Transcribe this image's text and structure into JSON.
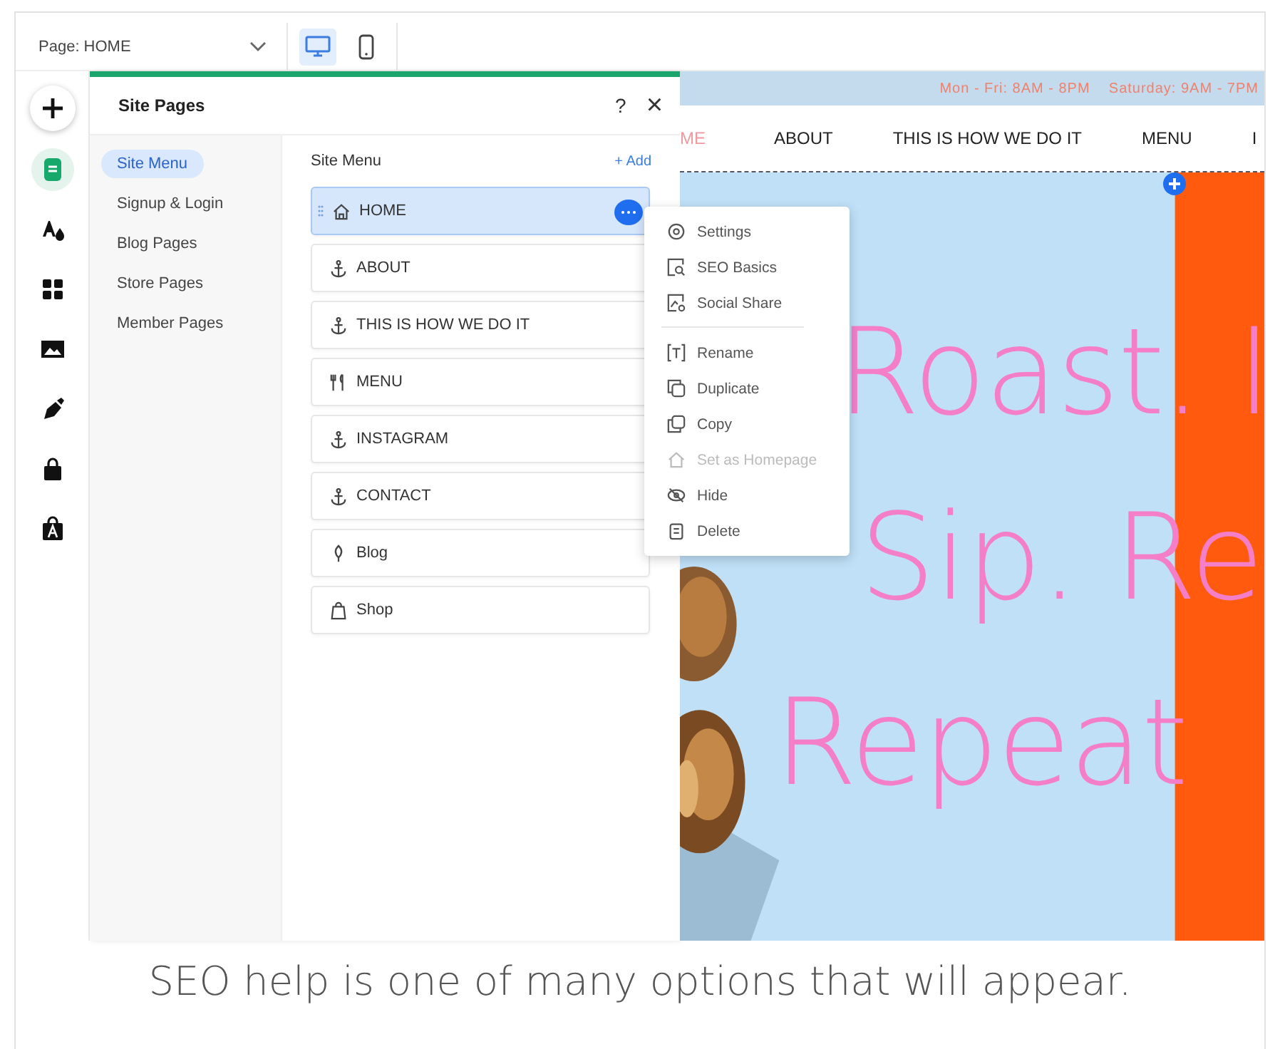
{
  "top_bar": {
    "page_label": "Page: HOME",
    "devices": [
      {
        "kind": "desktop",
        "selected": true
      },
      {
        "kind": "mobile",
        "selected": false
      }
    ]
  },
  "rail": [
    {
      "kind": "add",
      "selected": false
    },
    {
      "kind": "pages",
      "selected": true
    },
    {
      "kind": "theme",
      "selected": false
    },
    {
      "kind": "apps",
      "selected": false
    },
    {
      "kind": "media",
      "selected": false
    },
    {
      "kind": "pen",
      "selected": false
    },
    {
      "kind": "store",
      "selected": false
    },
    {
      "kind": "bag",
      "selected": false
    }
  ],
  "panel": {
    "title": "Site Pages",
    "help": "?",
    "close": "×",
    "categories": [
      {
        "label": "Site Menu",
        "selected": true
      },
      {
        "label": "Signup & Login",
        "selected": false
      },
      {
        "label": "Blog Pages",
        "selected": false
      },
      {
        "label": "Store Pages",
        "selected": false
      },
      {
        "label": "Member Pages",
        "selected": false
      }
    ],
    "list_title": "Site Menu",
    "add": "+ Add",
    "pages": [
      {
        "label": "HOME",
        "kind": "home",
        "selected": true
      },
      {
        "label": "ABOUT",
        "kind": "anchor",
        "selected": false
      },
      {
        "label": "THIS IS HOW WE DO IT",
        "kind": "anchor",
        "selected": false
      },
      {
        "label": "MENU",
        "kind": "food",
        "selected": false
      },
      {
        "label": "INSTAGRAM",
        "kind": "anchor",
        "selected": false
      },
      {
        "label": "CONTACT",
        "kind": "anchor",
        "selected": false
      },
      {
        "label": "Blog",
        "kind": "blog",
        "selected": false
      },
      {
        "label": "Shop",
        "kind": "shop",
        "selected": false
      }
    ]
  },
  "context_menu": [
    {
      "label": "Settings",
      "kind": "settings",
      "disabled": false
    },
    {
      "label": "SEO Basics",
      "kind": "seo",
      "disabled": false
    },
    {
      "label": "Social Share",
      "kind": "share",
      "disabled": false,
      "divider_after": true
    },
    {
      "label": "Rename",
      "kind": "rename",
      "disabled": false
    },
    {
      "label": "Duplicate",
      "kind": "duplicate",
      "disabled": false
    },
    {
      "label": "Copy",
      "kind": "copy",
      "disabled": false
    },
    {
      "label": "Set as Homepage",
      "kind": "home",
      "disabled": true
    },
    {
      "label": "Hide",
      "kind": "hide",
      "disabled": false
    },
    {
      "label": "Delete",
      "kind": "delete",
      "disabled": false
    }
  ],
  "preview": {
    "hours": "Mon - Fri: 8AM - 8PM    Saturday: 9AM - 7PM",
    "nav": [
      "ME",
      "ABOUT",
      "THIS IS HOW WE DO IT",
      "MENU",
      "I"
    ],
    "headline": [
      "Roast. I",
      "Sip. Re",
      "Repeat"
    ]
  },
  "caption": "SEO help is one of many options that will appear."
}
